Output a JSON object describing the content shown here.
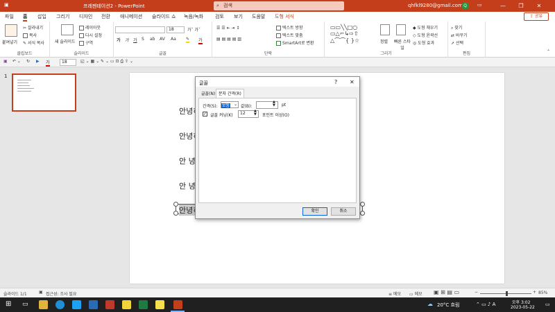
{
  "title_bar": {
    "window_title": "프레젠테이션2  -  PowerPoint",
    "search_placeholder": "검색",
    "account_email": "qhfkl9280@gmail.com",
    "avatar_initial": "Q"
  },
  "menu": {
    "tabs": [
      "파일",
      "홈",
      "삽입",
      "그리기",
      "디자인",
      "전환",
      "애니메이션",
      "슬라이드 쇼",
      "녹음/녹화",
      "검토",
      "보기",
      "도움말",
      "도형 서식"
    ],
    "active_tab": "홈",
    "share_label": "공유"
  },
  "ribbon": {
    "clipboard": {
      "paste": "붙여넣기",
      "cut": "잘라내기",
      "copy": "복사",
      "format_painter": "서식 복사",
      "label": "클립보드"
    },
    "slides": {
      "new_slide": "새 슬라이드",
      "layout": "레이아웃",
      "reset": "다시 설정",
      "section": "구역",
      "label": "슬라이드"
    },
    "font": {
      "font_size": "18",
      "label": "글꼴"
    },
    "paragraph": {
      "text_direction": "텍스트 방향",
      "align_text": "텍스트 맞춤",
      "smartart": "SmartArt로 변환",
      "label": "단락"
    },
    "drawing": {
      "arrange": "정렬",
      "quick_styles": "빠른 스타일",
      "shape_fill": "도형 채우기",
      "shape_outline": "도형 윤곽선",
      "shape_effects": "도형 효과",
      "label": "그리기"
    },
    "editing": {
      "find": "찾기",
      "replace": "바꾸기",
      "select": "선택",
      "label": "편집"
    }
  },
  "qat": {
    "font_size": "18"
  },
  "thumbnail": {
    "number": "1"
  },
  "slide": {
    "lines": [
      "안녕히",
      "안녕히",
      "안 녕",
      "안 녕",
      "안녕히"
    ]
  },
  "dialog": {
    "title": "글꼴",
    "help": "?",
    "close": "✕",
    "tabs": [
      "글꼴(N)",
      "문자 간격(R)"
    ],
    "active_tab": "문자 간격(R)",
    "spacing_label": "간격(S):",
    "spacing_value": "보통",
    "by_label": "값(B):",
    "by_value": "",
    "unit": "pt",
    "kerning_label": "글꼴 커닝(K)",
    "kerning_checked": true,
    "kerning_value": "12",
    "kerning_suffix": "포인트 이상(O)",
    "ok": "확인",
    "cancel": "취소"
  },
  "status_bar": {
    "slide_info": "슬라이드 1/1",
    "accessibility": "접근성: 조사 필요",
    "notes": "메모",
    "comments": "메모",
    "zoom": "85%"
  },
  "taskbar": {
    "weather": "20°C  흐림",
    "time": "오후 3:02",
    "date": "2023-05-22"
  }
}
